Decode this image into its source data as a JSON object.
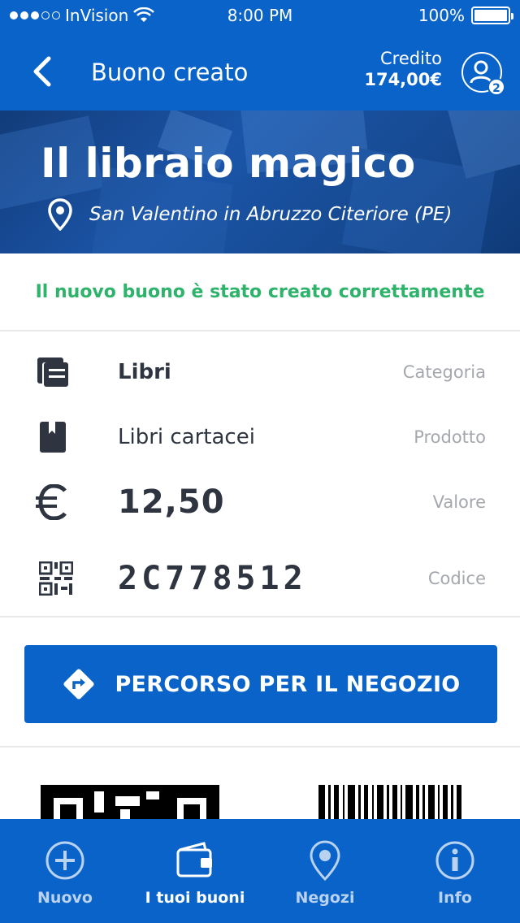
{
  "status_bar": {
    "carrier": "InVision",
    "time": "8:00 PM",
    "battery": "100%"
  },
  "header": {
    "title": "Buono creato",
    "credit_label": "Credito",
    "credit_value": "174,00€",
    "profile_badge": "2"
  },
  "hero": {
    "title": "Il libraio magico",
    "location": "San Valentino in Abruzzo Citeriore (PE)"
  },
  "success_message": "Il nuovo buono è stato creato correttamente",
  "details": [
    {
      "icon": "books-icon",
      "value": "Libri",
      "label": "Categoria"
    },
    {
      "icon": "book-icon",
      "value": "Libri cartacei",
      "label": "Prodotto"
    },
    {
      "icon": "euro-icon",
      "value": "12,50",
      "label": "Valore"
    },
    {
      "icon": "qr-code-icon",
      "value": "2C778512",
      "label": "Codice"
    }
  ],
  "route_button": {
    "label": "PERCORSO PER IL NEGOZIO"
  },
  "tabs": [
    {
      "label": "Nuovo",
      "icon": "plus-circle-icon",
      "active": false
    },
    {
      "label": "I tuoi buoni",
      "icon": "wallet-icon",
      "active": true
    },
    {
      "label": "Negozi",
      "icon": "map-pin-icon",
      "active": false
    },
    {
      "label": "Info",
      "icon": "info-icon",
      "active": false
    }
  ],
  "colors": {
    "primary": "#0a63c9",
    "success": "#2db36a",
    "text": "#2f3540",
    "muted": "#a4a7ad"
  }
}
